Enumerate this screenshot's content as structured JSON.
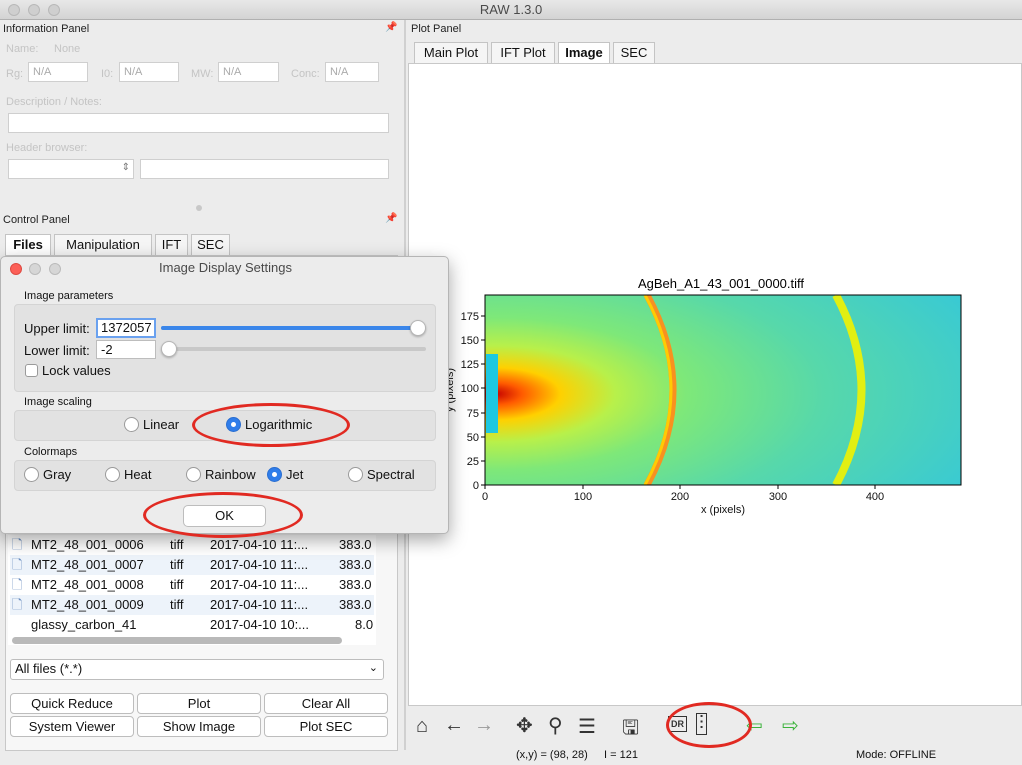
{
  "window": {
    "title": "RAW 1.3.0"
  },
  "info_panel": {
    "title": "Information Panel",
    "name_label": "Name:",
    "name_value": "None",
    "rg_label": "Rg:",
    "rg_value": "N/A",
    "i0_label": "I0:",
    "i0_value": "N/A",
    "mw_label": "MW:",
    "mw_value": "N/A",
    "conc_label": "Conc:",
    "conc_value": "N/A",
    "desc_label": "Description / Notes:",
    "header_label": "Header browser:"
  },
  "control_panel": {
    "title": "Control Panel",
    "tabs": [
      "Files",
      "Manipulation",
      "IFT",
      "SEC"
    ],
    "files": [
      {
        "name": "MT2_48_001_0006",
        "type": "tiff",
        "date": "2017-04-10 11:...",
        "size": "383.0"
      },
      {
        "name": "MT2_48_001_0007",
        "type": "tiff",
        "date": "2017-04-10 11:...",
        "size": "383.0"
      },
      {
        "name": "MT2_48_001_0008",
        "type": "tiff",
        "date": "2017-04-10 11:...",
        "size": "383.0"
      },
      {
        "name": "MT2_48_001_0009",
        "type": "tiff",
        "date": "2017-04-10 11:...",
        "size": "383.0"
      },
      {
        "name": "glassy_carbon_41",
        "type": "",
        "date": "2017-04-10 10:...",
        "size": "8.0"
      }
    ],
    "filter": "All files (*.*)",
    "buttons": [
      "Quick Reduce",
      "Plot",
      "Clear All",
      "System Viewer",
      "Show Image",
      "Plot SEC"
    ]
  },
  "plot_panel": {
    "title": "Plot Panel",
    "tabs": [
      "Main Plot",
      "IFT Plot",
      "Image",
      "SEC"
    ],
    "image_title": "AgBeh_A1_43_001_0000.tiff",
    "xlabel": "x (pixels)",
    "ylabel": "y (pixels)",
    "xticks": [
      "0",
      "100",
      "200",
      "300",
      "400"
    ],
    "yticks": [
      "0",
      "25",
      "50",
      "75",
      "100",
      "125",
      "150",
      "175"
    ]
  },
  "toolbar": {
    "icons": [
      "home-icon",
      "back-arrow-icon",
      "forward-arrow-icon",
      "pan-icon",
      "zoom-icon",
      "sliders-icon",
      "save-icon",
      "dr-icon",
      "image-settings-icon",
      "prev-green-icon",
      "next-green-icon"
    ],
    "dr_label": "DR"
  },
  "status_bar": {
    "coords": "(x,y) = (98, 28)",
    "intensity": "I = 121",
    "mode": "Mode: OFFLINE"
  },
  "dialog": {
    "title": "Image Display Settings",
    "params_label": "Image parameters",
    "upper_label": "Upper limit:",
    "upper_value": "1372057",
    "lower_label": "Lower limit:",
    "lower_value": "-2",
    "upper_slider": 1.0,
    "lower_slider": 0.0,
    "lock_label": "Lock values",
    "scaling_label": "Image scaling",
    "scaling_options": [
      "Linear",
      "Logarithmic"
    ],
    "scaling_selected": "Logarithmic",
    "colormaps_label": "Colormaps",
    "colormaps": [
      "Gray",
      "Heat",
      "Rainbow",
      "Jet",
      "Spectral"
    ],
    "colormap_selected": "Jet",
    "ok_label": "OK"
  }
}
